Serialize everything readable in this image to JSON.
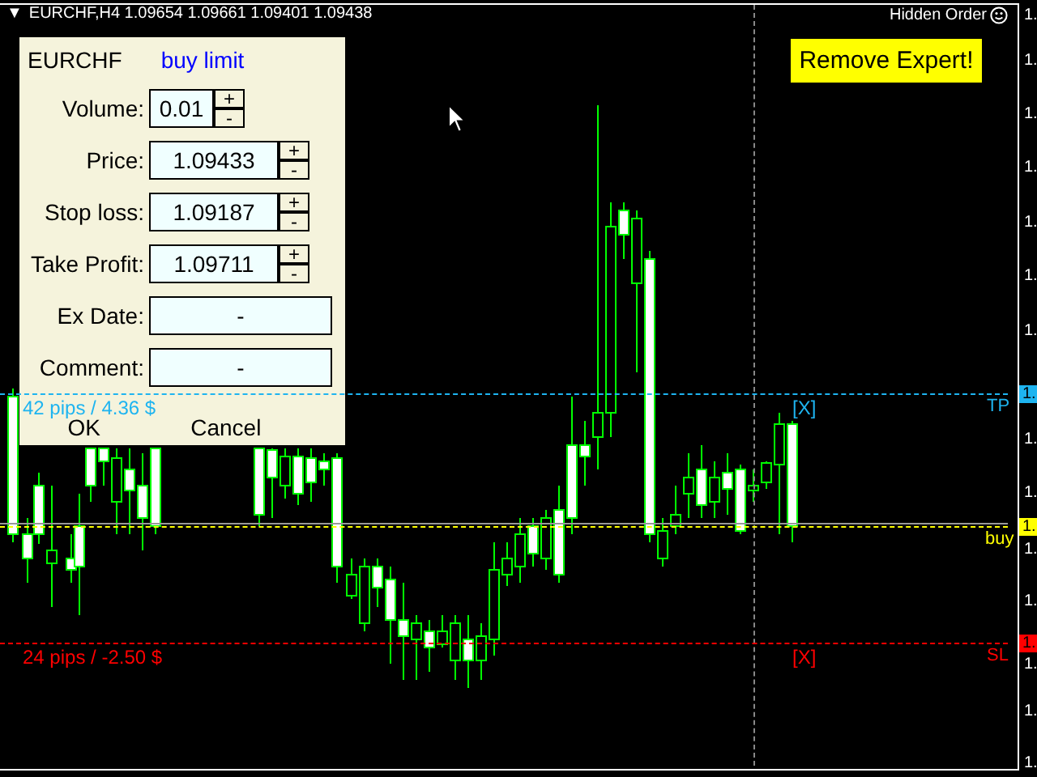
{
  "chart": {
    "title_arrow": "▼",
    "title": "EURCHF,H4  1.09654 1.09661 1.09401 1.09438",
    "hidden_order": "Hidden Order",
    "axis_labels": [
      "1.",
      "1.",
      "1.",
      "1.",
      "1.",
      "1.",
      "1.",
      "1.",
      "1.",
      "1.",
      "1.",
      "1.",
      "1.",
      "1."
    ],
    "lines": [
      {
        "kind": "tp",
        "pips": "42 pips / 4.36 $",
        "close": "[X]",
        "tag": "TP",
        "price_tag": "1.",
        "color": "#1eb4f0"
      },
      {
        "kind": "entry",
        "tag": "buy",
        "price_tag": "1.",
        "color": "#ffff00"
      },
      {
        "kind": "sl",
        "pips": "24 pips / -2.50 $",
        "close": "[X]",
        "tag": "SL",
        "price_tag": "1.",
        "color": "#ff0000"
      }
    ]
  },
  "remove_button": "Remove Expert!",
  "panel": {
    "symbol": "EURCHF",
    "order_type": "buy limit",
    "rows": [
      {
        "kind": "short-spin",
        "label": "Volume:",
        "value": "0.01",
        "increment": "+",
        "decrement": "-"
      },
      {
        "kind": "spin",
        "label": "Price:",
        "value": "1.09433",
        "increment": "+",
        "decrement": "-"
      },
      {
        "kind": "spin",
        "label": "Stop loss:",
        "value": "1.09187",
        "increment": "+",
        "decrement": "-"
      },
      {
        "kind": "spin",
        "label": "Take Profit:",
        "value": "1.09711",
        "increment": "+",
        "decrement": "-"
      },
      {
        "kind": "plain",
        "label": "Ex Date:",
        "value": "-"
      },
      {
        "kind": "plain",
        "label": "Comment:",
        "value": "-"
      }
    ],
    "buttons": [
      "OK",
      "Cancel"
    ]
  }
}
